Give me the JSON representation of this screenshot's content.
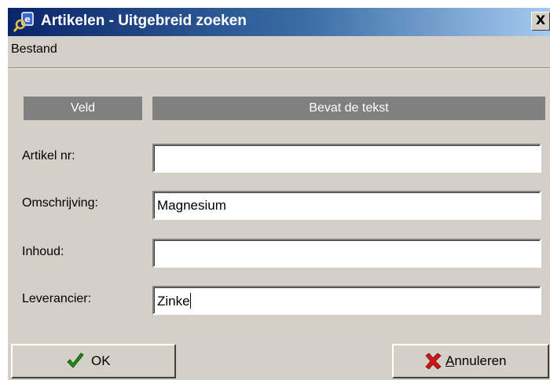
{
  "window": {
    "title": "Artikelen - Uitgebreid zoeken",
    "close_label": "X"
  },
  "menu": {
    "items": [
      {
        "label": "Bestand"
      }
    ]
  },
  "grid": {
    "headers": {
      "field": "Veld",
      "contains": "Bevat de tekst"
    },
    "rows": [
      {
        "label": "Artikel nr:",
        "value": ""
      },
      {
        "label": "Omschrijving:",
        "value": "Magnesium"
      },
      {
        "label": "Inhoud:",
        "value": ""
      },
      {
        "label": "Leverancier:",
        "value": "Zinke"
      }
    ]
  },
  "buttons": {
    "ok": {
      "label": "OK",
      "icon": "checkmark-icon",
      "color": "#1f8a1f"
    },
    "cancel": {
      "label_first": "A",
      "label_rest": "nnuleren",
      "icon": "red-x-icon",
      "color": "#cc1a1a"
    }
  },
  "colors": {
    "titlebar_start": "#0a246a",
    "titlebar_end": "#a6caf0",
    "face": "#d4d0c8",
    "header_bg": "#808080"
  }
}
